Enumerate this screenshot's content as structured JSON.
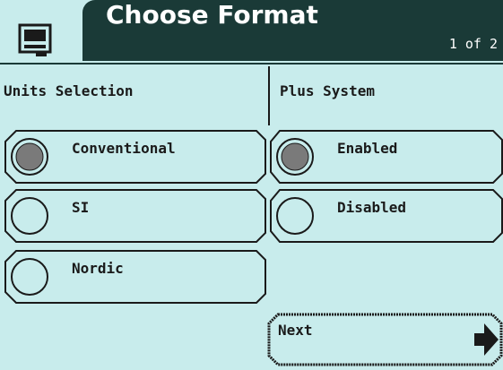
{
  "header": {
    "title": "Choose Format",
    "page_indicator": "1 of 2",
    "icon": "monitor-icon"
  },
  "columns": {
    "units_label": "Units Selection",
    "plus_label": "Plus System"
  },
  "units_options": [
    {
      "label": "Conventional",
      "selected": true
    },
    {
      "label": "SI",
      "selected": false
    },
    {
      "label": "Nordic",
      "selected": false
    }
  ],
  "plus_options": [
    {
      "label": "Enabled",
      "selected": true
    },
    {
      "label": "Disabled",
      "selected": false
    }
  ],
  "next_button": {
    "label": "Next",
    "icon": "arrow-right-icon"
  },
  "colors": {
    "background": "#c8ecec",
    "header": "#1a3a37",
    "ink": "#1a1a1a"
  }
}
